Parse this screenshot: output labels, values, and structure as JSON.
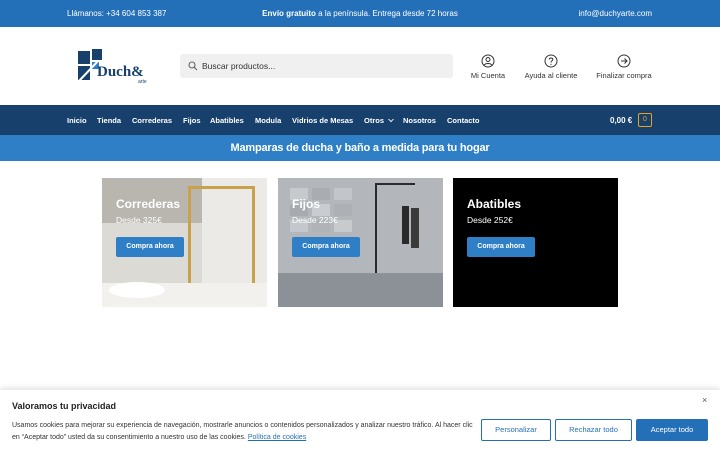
{
  "topbar": {
    "phone": "Llámanos: +34 604 853 387",
    "shipping_bold": "Envío gratuito",
    "shipping_rest": " a la península. Entrega desde 72 horas",
    "email": "info@duchyarte.com"
  },
  "header": {
    "logo_text": "Duch&",
    "logo_sub": "arte",
    "search_placeholder": "Buscar productos...",
    "links": {
      "account": "Mi Cuenta",
      "help": "Ayuda al cliente",
      "checkout": "Finalizar compra"
    }
  },
  "nav": {
    "items": [
      "Inicio",
      "Tienda",
      "Correderas",
      "Fijos",
      "Abatibles",
      "Modula",
      "Vidrios de Mesas",
      "Otros",
      "Nosotros",
      "Contacto"
    ],
    "cart_total": "0,00 €",
    "cart_count": "0"
  },
  "banner": {
    "text": "Mamparas de ducha y baño a medida para tu hogar"
  },
  "cards": [
    {
      "title": "Correderas",
      "price": "Desde 325€",
      "button": "Compra ahora"
    },
    {
      "title": "Fijos",
      "price": "Desde 223€",
      "button": "Compra ahora"
    },
    {
      "title": "Abatibles",
      "price": "Desde 252€",
      "button": "Compra ahora"
    }
  ],
  "cookie": {
    "title": "Valoramos tu privacidad",
    "close": "×",
    "text": "Usamos cookies para mejorar su experiencia de navegación, mostrarle anuncios o contenidos personalizados y analizar nuestro tráfico. Al hacer clic en “Aceptar todo” usted da su consentimiento a nuestro uso de las cookies.",
    "policy_link": "Política de cookies",
    "buttons": {
      "customize": "Personalizar",
      "reject": "Rechazar todo",
      "accept": "Aceptar todo"
    }
  },
  "colors": {
    "topbar": "#2470b8",
    "nav": "#17416c",
    "banner": "#2f7fc6",
    "button": "#2f7fc6",
    "cart_accent": "#e8a21a"
  },
  "icons": [
    "search-icon",
    "user-icon",
    "help-icon",
    "arrow-right-circle-icon",
    "chevron-down-icon",
    "close-icon"
  ]
}
